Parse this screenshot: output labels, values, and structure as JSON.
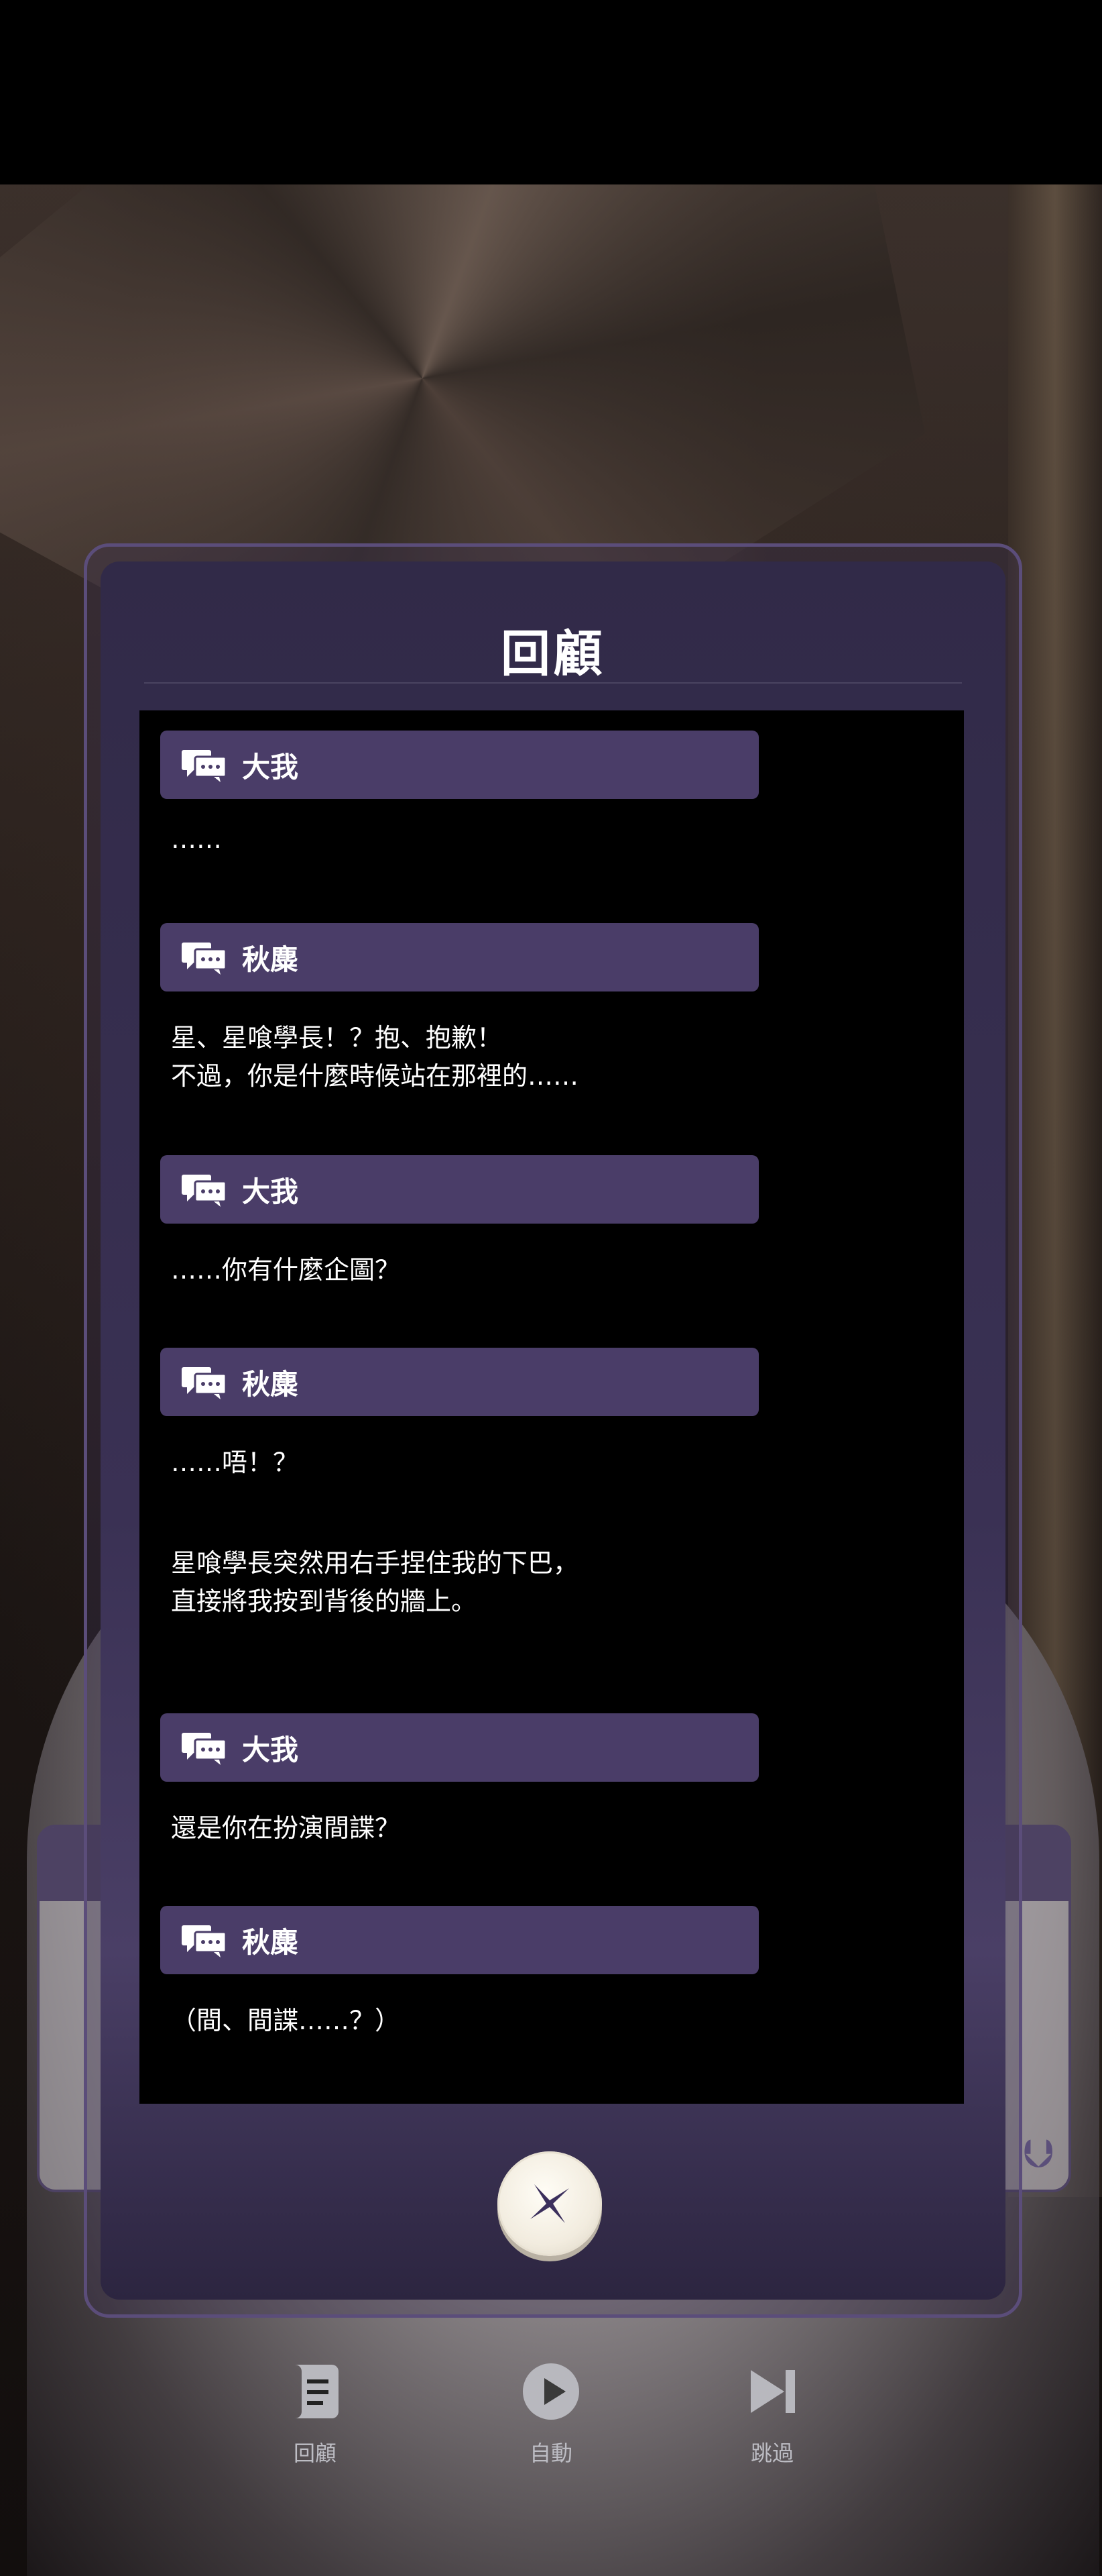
{
  "panel": {
    "title": "回顧"
  },
  "log": [
    {
      "speaker": "大我",
      "lines": [
        "……"
      ]
    },
    {
      "speaker": "秋麋",
      "lines": [
        "星、星喰學長！？抱、抱歉！",
        "不過，你是什麼時候站在那裡的……"
      ]
    },
    {
      "speaker": "大我",
      "lines": [
        "……你有什麼企圖？"
      ]
    },
    {
      "speaker": "秋麋",
      "lines": [
        "……唔！？"
      ]
    },
    {
      "speaker": "",
      "lines": [
        "星喰學長突然用右手捏住我的下巴，",
        "直接將我按到背後的牆上。"
      ]
    },
    {
      "speaker": "大我",
      "lines": [
        "還是你在扮演間諜？"
      ]
    },
    {
      "speaker": "秋麋",
      "lines": [
        "（間、間諜……？）"
      ]
    }
  ],
  "nav": {
    "review": "回顧",
    "auto": "自動",
    "skip": "跳過"
  },
  "icons": {
    "speaker": "speech-bubbles-icon",
    "close": "close-x-icon",
    "review": "scroll-icon",
    "auto": "play-icon",
    "skip": "skip-forward-icon",
    "chevron": "double-chevron-down-icon"
  },
  "colors": {
    "name_bar": "#4a3d68",
    "panel": "#3a3154",
    "close_button": "#f2ecdf",
    "close_x": "#3b2f5c"
  }
}
